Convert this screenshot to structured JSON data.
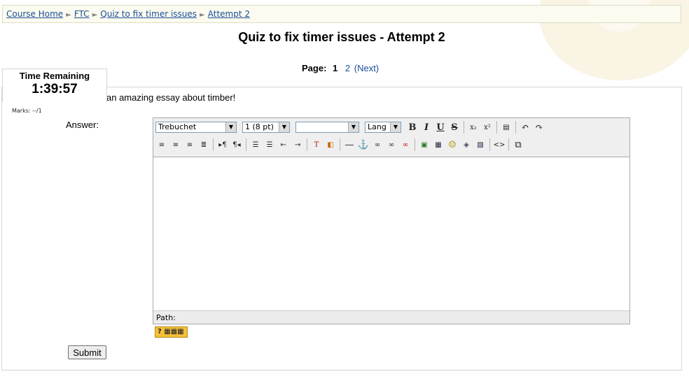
{
  "breadcrumb": {
    "items": [
      "Course Home",
      "FTC",
      "Quiz to fix timer issues",
      "Attempt 2"
    ],
    "separator": "►"
  },
  "page_title": "Quiz to fix timer issues - Attempt 2",
  "paging": {
    "label": "Page:",
    "current": "1",
    "other": "2",
    "next": "(Next)"
  },
  "timer": {
    "label": "Time Remaining",
    "value": "1:39:57"
  },
  "question": {
    "marks": "Marks: --/1",
    "text": "an amazing essay about timber!",
    "answer_label": "Answer:"
  },
  "editor": {
    "font_select": "Trebuchet",
    "size_select": "1 (8 pt)",
    "format_select": "",
    "lang_select": "Lang",
    "path_label": "Path:"
  },
  "submit_label": "Submit",
  "colors": {
    "link": "#1a4e99",
    "breadcrumb_bg": "#fbfbf0",
    "help_button": "#f5c13b"
  },
  "icons": {
    "row1": [
      "bold-icon",
      "italic-icon",
      "underline-icon",
      "strikethrough-icon",
      "subscript-icon",
      "superscript-icon",
      "paste-word-icon",
      "undo-icon",
      "redo-icon"
    ],
    "row2": [
      "align-left-icon",
      "align-center-icon",
      "align-right-icon",
      "align-justify-icon",
      "ltr-icon",
      "rtl-icon",
      "ordered-list-icon",
      "unordered-list-icon",
      "outdent-icon",
      "indent-icon",
      "text-color-icon",
      "background-color-icon",
      "horizontal-rule-icon",
      "anchor-icon",
      "link-icon",
      "unlink-icon",
      "nolink-icon",
      "image-icon",
      "table-icon",
      "smiley-icon",
      "special-char-icon",
      "search-replace-icon",
      "html-source-icon",
      "fullscreen-icon"
    ]
  }
}
